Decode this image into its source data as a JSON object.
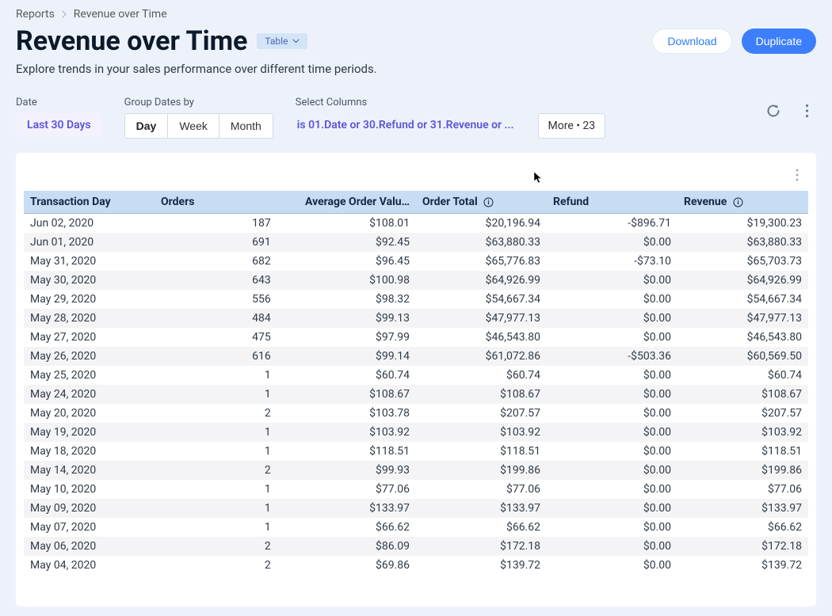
{
  "breadcrumbs": {
    "root": "Reports",
    "current": "Revenue over Time"
  },
  "title": "Revenue over Time",
  "mode_chip": "Table",
  "actions": {
    "download": "Download",
    "duplicate": "Duplicate"
  },
  "subtitle": "Explore trends in your sales performance over different time periods.",
  "controls": {
    "date_label": "Date",
    "date_value": "Last 30 Days",
    "group_label": "Group Dates by",
    "group_options": {
      "day": "Day",
      "week": "Week",
      "month": "Month"
    },
    "columns_label": "Select Columns",
    "columns_value": "is 01.Date or 30.Refund or 31.Revenue or ...",
    "more_label": "More • 23"
  },
  "table": {
    "headers": {
      "date": "Transaction Day",
      "orders": "Orders",
      "aov": "Average Order Valu…",
      "total": "Order Total",
      "refund": "Refund",
      "revenue": "Revenue"
    },
    "rows": [
      {
        "date": "Jun 02, 2020",
        "orders": "187",
        "aov": "$108.01",
        "total": "$20,196.94",
        "refund": "-$896.71",
        "revenue": "$19,300.23"
      },
      {
        "date": "Jun 01, 2020",
        "orders": "691",
        "aov": "$92.45",
        "total": "$63,880.33",
        "refund": "$0.00",
        "revenue": "$63,880.33"
      },
      {
        "date": "May 31, 2020",
        "orders": "682",
        "aov": "$96.45",
        "total": "$65,776.83",
        "refund": "-$73.10",
        "revenue": "$65,703.73"
      },
      {
        "date": "May 30, 2020",
        "orders": "643",
        "aov": "$100.98",
        "total": "$64,926.99",
        "refund": "$0.00",
        "revenue": "$64,926.99"
      },
      {
        "date": "May 29, 2020",
        "orders": "556",
        "aov": "$98.32",
        "total": "$54,667.34",
        "refund": "$0.00",
        "revenue": "$54,667.34"
      },
      {
        "date": "May 28, 2020",
        "orders": "484",
        "aov": "$99.13",
        "total": "$47,977.13",
        "refund": "$0.00",
        "revenue": "$47,977.13"
      },
      {
        "date": "May 27, 2020",
        "orders": "475",
        "aov": "$97.99",
        "total": "$46,543.80",
        "refund": "$0.00",
        "revenue": "$46,543.80"
      },
      {
        "date": "May 26, 2020",
        "orders": "616",
        "aov": "$99.14",
        "total": "$61,072.86",
        "refund": "-$503.36",
        "revenue": "$60,569.50"
      },
      {
        "date": "May 25, 2020",
        "orders": "1",
        "aov": "$60.74",
        "total": "$60.74",
        "refund": "$0.00",
        "revenue": "$60.74"
      },
      {
        "date": "May 24, 2020",
        "orders": "1",
        "aov": "$108.67",
        "total": "$108.67",
        "refund": "$0.00",
        "revenue": "$108.67"
      },
      {
        "date": "May 20, 2020",
        "orders": "2",
        "aov": "$103.78",
        "total": "$207.57",
        "refund": "$0.00",
        "revenue": "$207.57"
      },
      {
        "date": "May 19, 2020",
        "orders": "1",
        "aov": "$103.92",
        "total": "$103.92",
        "refund": "$0.00",
        "revenue": "$103.92"
      },
      {
        "date": "May 18, 2020",
        "orders": "1",
        "aov": "$118.51",
        "total": "$118.51",
        "refund": "$0.00",
        "revenue": "$118.51"
      },
      {
        "date": "May 14, 2020",
        "orders": "2",
        "aov": "$99.93",
        "total": "$199.86",
        "refund": "$0.00",
        "revenue": "$199.86"
      },
      {
        "date": "May 10, 2020",
        "orders": "1",
        "aov": "$77.06",
        "total": "$77.06",
        "refund": "$0.00",
        "revenue": "$77.06"
      },
      {
        "date": "May 09, 2020",
        "orders": "1",
        "aov": "$133.97",
        "total": "$133.97",
        "refund": "$0.00",
        "revenue": "$133.97"
      },
      {
        "date": "May 07, 2020",
        "orders": "1",
        "aov": "$66.62",
        "total": "$66.62",
        "refund": "$0.00",
        "revenue": "$66.62"
      },
      {
        "date": "May 06, 2020",
        "orders": "2",
        "aov": "$86.09",
        "total": "$172.18",
        "refund": "$0.00",
        "revenue": "$172.18"
      },
      {
        "date": "May 04, 2020",
        "orders": "2",
        "aov": "$69.86",
        "total": "$139.72",
        "refund": "$0.00",
        "revenue": "$139.72"
      }
    ]
  }
}
